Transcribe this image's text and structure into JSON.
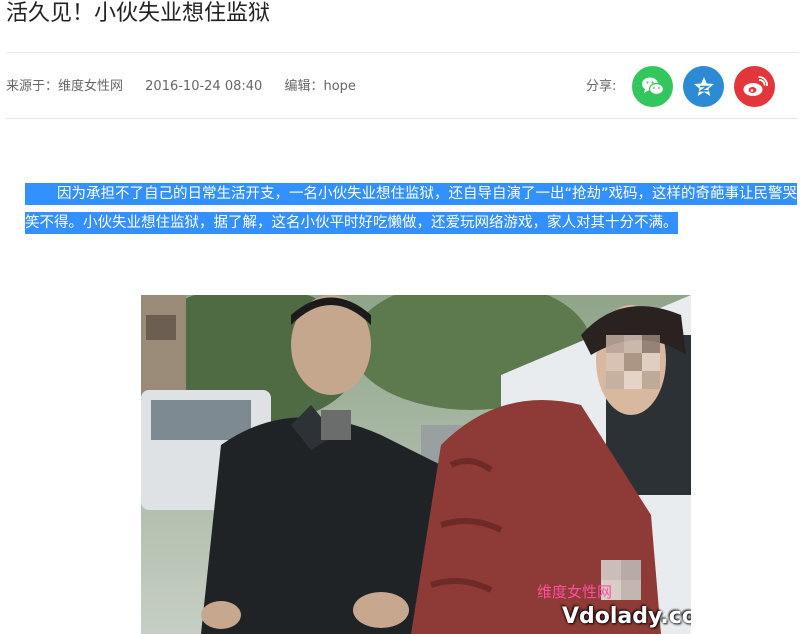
{
  "article": {
    "title": "活久见！小伙失业想住监狱",
    "source": "来源于：维度女性网",
    "datetime": "2016-10-24 08:40",
    "editor": "编辑：hope",
    "body": "因为承担不了自己的日常生活开支，一名小伙失业想住监狱，还自导自演了一出“抢劫”戏码，这样的奇葩事让民警哭笑不得。小伙失业想住监狱，据了解，这名小伙平时好吃懒做，还爱玩网络游戏，家人对其十分不满。"
  },
  "share": {
    "label": "分享:",
    "buttons": [
      {
        "icon": "wechat-icon",
        "color": "#33c65c"
      },
      {
        "icon": "qzone-icon",
        "color": "#2d8bd6"
      },
      {
        "icon": "weibo-icon",
        "color": "#e2363a"
      }
    ]
  },
  "photo": {
    "watermark_cn": "维度女性网",
    "watermark_url": "Vdolady.com"
  },
  "colors": {
    "selection": "#3390ff"
  }
}
